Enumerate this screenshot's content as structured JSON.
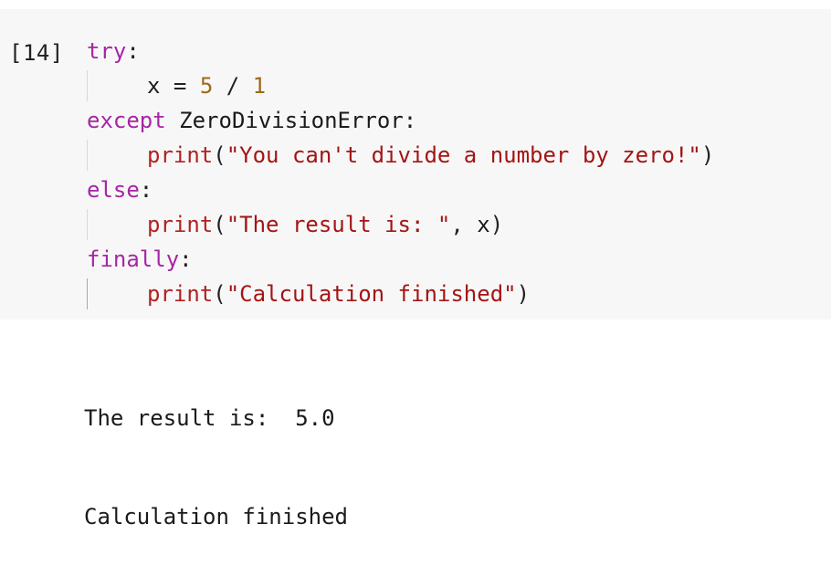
{
  "cell": {
    "execution_count": "[14]",
    "lines": {
      "l1": {
        "kw": "try",
        "punct": ":"
      },
      "l2": {
        "var": "x",
        "eq": " = ",
        "num1": "5",
        "op": " / ",
        "num2": "1"
      },
      "l3": {
        "kw": "except",
        "space": " ",
        "name": "ZeroDivisionError",
        "punct": ":"
      },
      "l4": {
        "fn": "print",
        "open": "(",
        "str": "\"You can't divide a number by zero!\"",
        "close": ")"
      },
      "l5": {
        "kw": "else",
        "punct": ":"
      },
      "l6": {
        "fn": "print",
        "open": "(",
        "str": "\"The result is: \"",
        "sep": ", ",
        "var": "x",
        "close": ")"
      },
      "l7": {
        "kw": "finally",
        "punct": ":"
      },
      "l8": {
        "fn": "print",
        "open": "(",
        "str": "\"Calculation finished\"",
        "close": ")"
      }
    }
  },
  "output": {
    "lines": [
      "The result is:  5.0",
      "Calculation finished"
    ]
  },
  "colors": {
    "keyword": "#a626a4",
    "string": "#a31515",
    "number": "#9c6a1a",
    "builtin": "#b22222",
    "cell_background": "#f7f7f7"
  }
}
